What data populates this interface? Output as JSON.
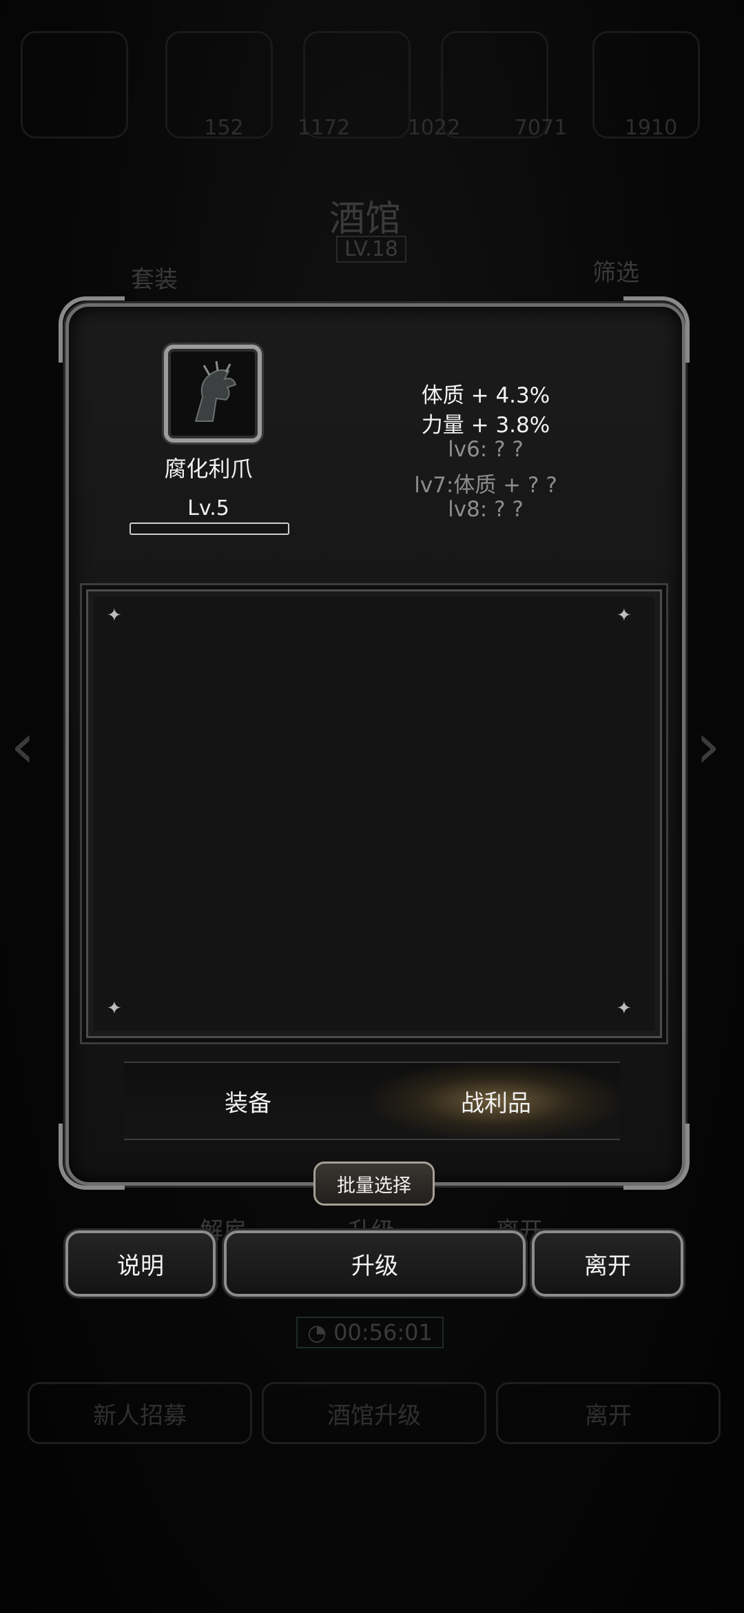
{
  "background": {
    "title": "酒馆",
    "level_badge": "LV.18",
    "left_tab": "套装",
    "right_tab": "筛选",
    "counts": [
      "152",
      "1172",
      "1022",
      "7071",
      "1910"
    ],
    "under_buttons": [
      "解雇",
      "升级",
      "离开"
    ],
    "timer": "00:56:01",
    "bottom_buttons": [
      "新人招募",
      "酒馆升级",
      "离开"
    ]
  },
  "item": {
    "icon": "claw-icon",
    "name": "腐化利爪",
    "level_label": "Lv.5",
    "level_progress": 0
  },
  "stats": [
    {
      "text": "体质 + 4.3%",
      "unlocked": true
    },
    {
      "text": "力量 + 3.8%",
      "unlocked": true
    },
    {
      "text": "lv6: ? ?",
      "unlocked": false
    },
    {
      "text": "lv7:体质 + ? ?",
      "unlocked": false
    },
    {
      "text": "lv8: ? ?",
      "unlocked": false
    }
  ],
  "tabs": [
    {
      "label": "装备",
      "selected": false
    },
    {
      "label": "战利品",
      "selected": true
    }
  ],
  "batch_select": "批量选择",
  "actions": {
    "info": "说明",
    "upgrade": "升级",
    "leave": "离开"
  },
  "colors": {
    "panel_border": "#6e6e6e",
    "selected_tab_glow": "#b4965a",
    "text": "#f0f0f0",
    "locked_text": "#8d8d8d"
  }
}
